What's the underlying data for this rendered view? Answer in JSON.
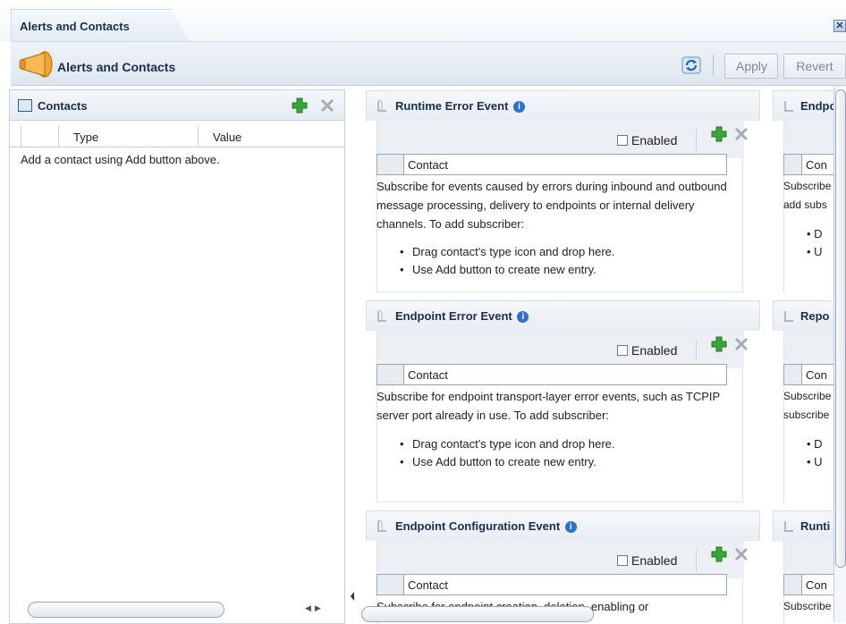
{
  "window": {
    "tab_label": "Alerts and Contacts",
    "close_glyph": "✕"
  },
  "header": {
    "title": "Alerts and Contacts",
    "apply_label": "Apply",
    "revert_label": "Revert"
  },
  "contacts": {
    "title": "Contacts",
    "columns": [
      "",
      "Type",
      "Value"
    ],
    "empty_message": "Add a contact using Add button above."
  },
  "events": [
    {
      "title": "Runtime Error Event",
      "enabled_label": "Enabled",
      "contact_column": "Contact",
      "description": "Subscribe for events caused by errors during inbound and outbound message processing, delivery to endpoints or internal delivery channels.   To add subscriber:",
      "bullets": [
        "Drag contact's type icon and drop here.",
        "Use Add button to create new entry."
      ]
    },
    {
      "title": "Endpoint Error Event",
      "enabled_label": "Enabled",
      "contact_column": "Contact",
      "description": "Subscribe for endpoint transport-layer error events, such as TCPIP server port already in use.  To add subscriber:",
      "bullets": [
        "Drag contact's type icon and drop here.",
        "Use Add button to create new entry."
      ]
    },
    {
      "title": "Endpoint Configuration Event",
      "enabled_label": "Enabled",
      "contact_column": "Contact",
      "description": "Subscribe for endpoint creation, deletion, enabling or"
    }
  ],
  "right_panels": [
    {
      "title": "Endpo",
      "contact_column": "Con",
      "lines": [
        "Subscribe",
        "add subs"
      ],
      "bullets": [
        "D",
        "U"
      ]
    },
    {
      "title": "Repo",
      "contact_column": "Con",
      "lines": [
        "Subscribe",
        "subscribe"
      ],
      "bullets": [
        "D",
        "U"
      ]
    },
    {
      "title": "Runti",
      "contact_column": "Con",
      "lines": [
        "Subscribe"
      ]
    }
  ],
  "colors": {
    "add_green": "#2f9a2b",
    "title_navy": "#1b2d4a",
    "info_blue": "#2f6fc9"
  }
}
